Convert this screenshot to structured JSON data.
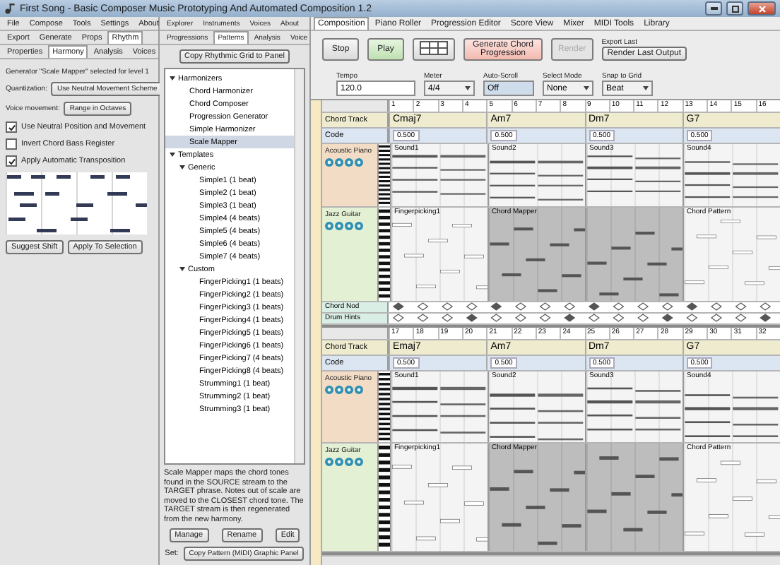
{
  "window": {
    "title": "First Song - Basic Composer Music Prototyping And Automated Composition 1.2"
  },
  "left_panel": {
    "menu_rows": [
      [
        {
          "label": "File",
          "selected": false
        },
        {
          "label": "Compose",
          "selected": false
        },
        {
          "label": "Tools",
          "selected": false
        },
        {
          "label": "Settings",
          "selected": false
        },
        {
          "label": "About",
          "selected": false
        }
      ],
      [
        {
          "label": "Export",
          "selected": false
        },
        {
          "label": "Generate",
          "selected": false
        },
        {
          "label": "Props",
          "selected": false
        },
        {
          "label": "Rhythm",
          "selected": true
        }
      ],
      [
        {
          "label": "Properties",
          "selected": false
        },
        {
          "label": "Harmony",
          "selected": true
        },
        {
          "label": "Analysis",
          "selected": false
        },
        {
          "label": "Voices",
          "selected": false
        }
      ]
    ],
    "caption": "Generator \"Scale Mapper\" selected for level 1",
    "settings": [
      {
        "label": "Quantization:",
        "button": "Use Neutral Movement Scheme"
      },
      {
        "label": "Voice movement:",
        "button": "Range in Octaves"
      }
    ],
    "options": [
      {
        "label": "Use Neutral Position and Movement",
        "checked": true
      },
      {
        "label": "Invert Chord Bass Register",
        "checked": false
      },
      {
        "label": "Apply Automatic Transposition",
        "checked": true
      }
    ],
    "buttons": [
      "Suggest Shift",
      "Apply To Selection"
    ]
  },
  "middle_panel": {
    "tab_rows": [
      [
        {
          "label": "Explorer",
          "selected": false
        },
        {
          "label": "Instruments",
          "selected": false
        },
        {
          "label": "Voices",
          "selected": false
        },
        {
          "label": "About",
          "selected": false
        }
      ],
      [
        {
          "label": "Progressions",
          "selected": false
        },
        {
          "label": "Patterns",
          "selected": true
        },
        {
          "label": "Analysis",
          "selected": false
        },
        {
          "label": "Voice",
          "selected": false
        }
      ]
    ],
    "copy_button": "Copy Rhythmic Grid to Panel",
    "tree": [
      {
        "label": "Harmonizers",
        "expanded": true,
        "selected": false,
        "children": [
          {
            "label": "Chord Harmonizer",
            "selected": false
          },
          {
            "label": "Chord Composer",
            "selected": false
          },
          {
            "label": "Progression Generator",
            "selected": false
          },
          {
            "label": "Simple Harmonizer",
            "selected": false
          },
          {
            "label": "Scale Mapper",
            "selected": true
          }
        ]
      },
      {
        "label": "Templates",
        "expanded": true,
        "selected": false,
        "children": [
          {
            "label": "Generic",
            "expanded": true,
            "selected": false,
            "children": [
              {
                "label": "Simple1 (1 beat)",
                "selected": false
              },
              {
                "label": "Simple2 (1 beat)",
                "selected": false
              },
              {
                "label": "Simple3 (1 beat)",
                "selected": false
              },
              {
                "label": "Simple4 (4 beats)",
                "selected": false
              },
              {
                "label": "Simple5 (4 beats)",
                "selected": false
              },
              {
                "label": "Simple6 (4 beats)",
                "selected": false
              },
              {
                "label": "Simple7 (4 beats)",
                "selected": false
              }
            ]
          },
          {
            "label": "Custom",
            "expanded": true,
            "selected": false,
            "children": [
              {
                "label": "FingerPicking1 (1 beats)",
                "selected": false
              },
              {
                "label": "FingerPicking2 (1 beats)",
                "selected": false
              },
              {
                "label": "FingerPicking3 (1 beats)",
                "selected": false
              },
              {
                "label": "FingerPicking4 (1 beats)",
                "selected": false
              },
              {
                "label": "FingerPicking5 (1 beats)",
                "selected": false
              },
              {
                "label": "FingerPicking6 (1 beats)",
                "selected": false
              },
              {
                "label": "FingerPicking7 (4 beats)",
                "selected": false
              },
              {
                "label": "FingerPicking8 (4 beats)",
                "selected": false
              },
              {
                "label": "Strumming1 (1 beat)",
                "selected": false
              },
              {
                "label": "Strumming2 (1 beat)",
                "selected": false
              },
              {
                "label": "Strumming3 (1 beat)",
                "selected": false
              }
            ]
          }
        ]
      }
    ],
    "description": "Scale Mapper maps the chord tones found in the SOURCE stream to the TARGET phrase. Notes out of scale are moved to the CLOSEST chord tone. The TARGET stream is then regenerated from the new harmony.",
    "buttons": [
      "Manage",
      "Rename",
      "Edit"
    ],
    "set_label": "Set:",
    "set_button": "Copy Pattern (MIDI) Graphic Panel"
  },
  "composition": {
    "tabs": [
      {
        "label": "Composition",
        "selected": true
      },
      {
        "label": "Piano Roller",
        "selected": false
      },
      {
        "label": "Progression Editor",
        "selected": false
      },
      {
        "label": "Score View",
        "selected": false
      },
      {
        "label": "Mixer",
        "selected": false
      },
      {
        "label": "MIDI Tools",
        "selected": false
      },
      {
        "label": "Library",
        "selected": false
      }
    ],
    "toolbar": [
      {
        "kind": "button",
        "label": "Stop"
      },
      {
        "kind": "play",
        "label": "Play"
      },
      {
        "kind": "grid"
      },
      {
        "kind": "primary",
        "label": "Generate Chord Progression"
      },
      {
        "kind": "disabled",
        "label": "Render"
      }
    ],
    "export": {
      "caption": "Export Last",
      "button": "Render Last Output"
    },
    "fields": [
      {
        "label": "Tempo",
        "value": "120.0",
        "kind": "text"
      },
      {
        "label": "Meter",
        "value": "4/4",
        "kind": "dropdown"
      },
      {
        "label": "Auto-Scroll",
        "value": "Off",
        "kind": "toggle"
      },
      {
        "label": "Select Mode",
        "value": "None",
        "kind": "dropdown"
      },
      {
        "label": "Snap to Grid",
        "value": "Beat",
        "kind": "dropdown"
      }
    ],
    "systems": [
      {
        "beats": [
          "1",
          "2",
          "3",
          "4",
          "5",
          "6",
          "7",
          "8",
          "9",
          "10",
          "11",
          "12",
          "13",
          "14",
          "15",
          "16"
        ],
        "chord_track": "Chord Track",
        "code_track": "Code",
        "chords": [
          "Cmaj7",
          "Am7",
          "Dm7",
          "G7"
        ],
        "code_values": [
          "0.500",
          "0.500",
          "0.500",
          "0.500"
        ],
        "tracks": [
          {
            "name": "Acoustic Piano",
            "kind": "piano",
            "color": "#f2dcc6",
            "blocks": [
              {
                "label": "Sound1",
                "shaded": false
              },
              {
                "label": "Sound2",
                "shaded": false
              },
              {
                "label": "Sound3",
                "shaded": false
              },
              {
                "label": "Sound4",
                "shaded": false
              }
            ]
          },
          {
            "name": "Jazz Guitar",
            "kind": "guitar",
            "color": "#e3f0d3",
            "blocks": [
              {
                "label": "Fingerpicking1",
                "shaded": false
              },
              {
                "label": "Chord Mapper",
                "shaded": true
              },
              {
                "shaded": true
              },
              {
                "label": "Chord Pattern",
                "shaded": false
              }
            ]
          }
        ],
        "marker_rows": [
          "Chord Nod",
          "Drum Hints"
        ]
      },
      {
        "beats": [
          "17",
          "18",
          "19",
          "20",
          "21",
          "22",
          "23",
          "24",
          "25",
          "26",
          "27",
          "28",
          "29",
          "30",
          "31",
          "32"
        ],
        "chord_track": "Chord Track",
        "code_track": "Code",
        "chords": [
          "Emaj7",
          "Am7",
          "Dm7",
          "G7"
        ],
        "code_values": [
          "0.500",
          "0.500",
          "0.500",
          "0.500"
        ],
        "tracks": [
          {
            "name": "Acoustic Piano",
            "kind": "piano",
            "color": "#f2dcc6",
            "blocks": [
              {
                "label": "Sound1",
                "shaded": false
              },
              {
                "label": "Sound2",
                "shaded": false
              },
              {
                "label": "Sound3",
                "shaded": false
              },
              {
                "label": "Sound4",
                "shaded": false
              }
            ]
          },
          {
            "name": "Jazz Guitar",
            "kind": "guitar",
            "color": "#e3f0d3",
            "blocks": [
              {
                "label": "Fingerpicking1",
                "shaded": false
              },
              {
                "label": "Chord Mapper",
                "shaded": true
              },
              {
                "shaded": true
              },
              {
                "label": "Chord Pattern",
                "shaded": false
              }
            ]
          }
        ]
      }
    ]
  }
}
